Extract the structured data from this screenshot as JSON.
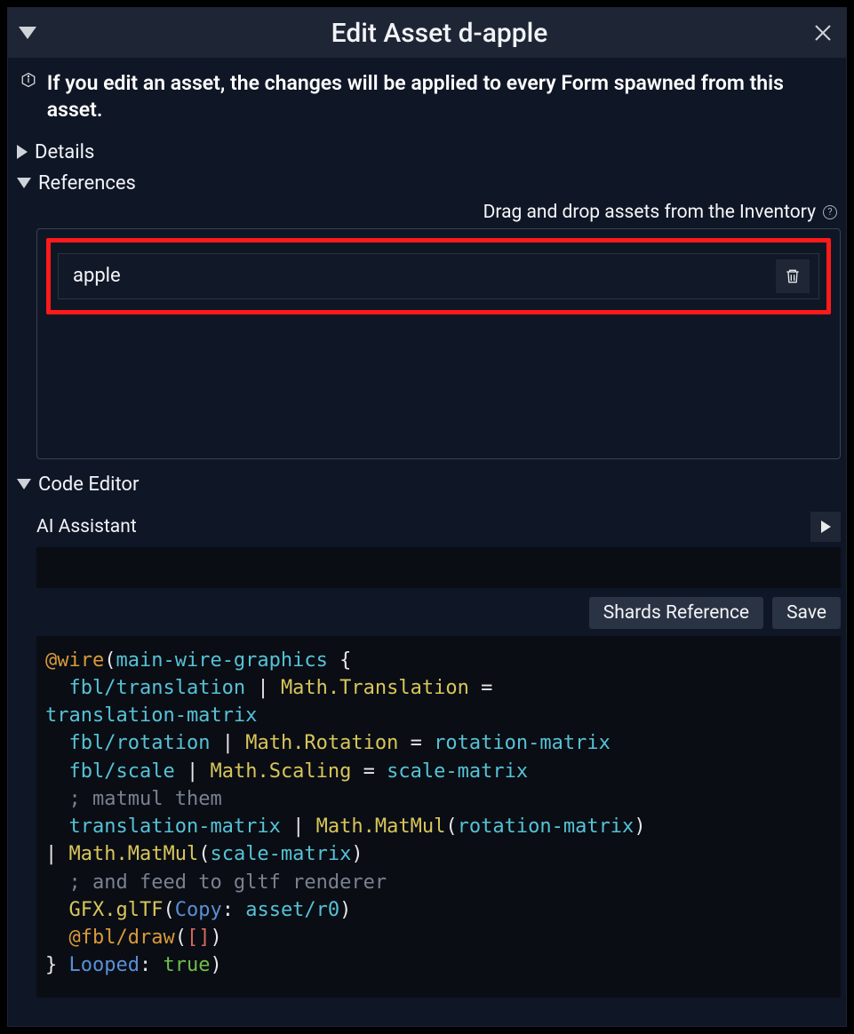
{
  "titlebar": {
    "title": "Edit Asset d-apple"
  },
  "info": {
    "text": "If you edit an asset, the changes will be applied to every Form spawned from this asset."
  },
  "sections": {
    "details_label": "Details",
    "references_label": "References",
    "code_editor_label": "Code Editor"
  },
  "references": {
    "hint": "Drag and drop assets from the Inventory",
    "items": [
      {
        "name": "apple"
      }
    ]
  },
  "code_editor": {
    "ai_label": "AI Assistant",
    "buttons": {
      "shards_ref": "Shards Reference",
      "save": "Save"
    },
    "code_tokens": [
      [
        [
          "orange",
          "@wire"
        ],
        [
          "white",
          "("
        ],
        [
          "cyan",
          "main-wire-graphics"
        ],
        [
          "white",
          " {"
        ]
      ],
      [
        [
          "white",
          "  "
        ],
        [
          "cyan",
          "fbl/translation"
        ],
        [
          "white",
          " | "
        ],
        [
          "yellow",
          "Math.Translation"
        ],
        [
          "white",
          " ="
        ]
      ],
      [
        [
          "cyan",
          "translation-matrix"
        ]
      ],
      [
        [
          "white",
          "  "
        ],
        [
          "cyan",
          "fbl/rotation"
        ],
        [
          "white",
          " | "
        ],
        [
          "yellow",
          "Math.Rotation"
        ],
        [
          "white",
          " = "
        ],
        [
          "cyan",
          "rotation-matrix"
        ]
      ],
      [
        [
          "white",
          "  "
        ],
        [
          "cyan",
          "fbl/scale"
        ],
        [
          "white",
          " | "
        ],
        [
          "yellow",
          "Math.Scaling"
        ],
        [
          "white",
          " = "
        ],
        [
          "cyan",
          "scale-matrix"
        ]
      ],
      [
        [
          "white",
          "  "
        ],
        [
          "gray",
          "; matmul them"
        ]
      ],
      [
        [
          "white",
          "  "
        ],
        [
          "cyan",
          "translation-matrix"
        ],
        [
          "white",
          " | "
        ],
        [
          "yellow",
          "Math.MatMul"
        ],
        [
          "white",
          "("
        ],
        [
          "cyan",
          "rotation-matrix"
        ],
        [
          "white",
          ")"
        ]
      ],
      [
        [
          "white",
          "| "
        ],
        [
          "yellow",
          "Math.MatMul"
        ],
        [
          "white",
          "("
        ],
        [
          "cyan",
          "scale-matrix"
        ],
        [
          "white",
          ")"
        ]
      ],
      [
        [
          "white",
          "  "
        ],
        [
          "gray",
          "; and feed to gltf renderer"
        ]
      ],
      [
        [
          "white",
          "  "
        ],
        [
          "yellow",
          "GFX.glTF"
        ],
        [
          "white",
          "("
        ],
        [
          "blue",
          "Copy"
        ],
        [
          "white",
          ": "
        ],
        [
          "cyan",
          "asset/r0"
        ],
        [
          "white",
          ")"
        ]
      ],
      [
        [
          "white",
          "  "
        ],
        [
          "orange",
          "@fbl/draw"
        ],
        [
          "white",
          "("
        ],
        [
          "red",
          "["
        ],
        [
          "red",
          "]"
        ],
        [
          "white",
          ")"
        ]
      ],
      [
        [
          "white",
          "} "
        ],
        [
          "blue",
          "Looped"
        ],
        [
          "white",
          ": "
        ],
        [
          "green",
          "true"
        ],
        [
          "white",
          ")"
        ]
      ]
    ]
  }
}
